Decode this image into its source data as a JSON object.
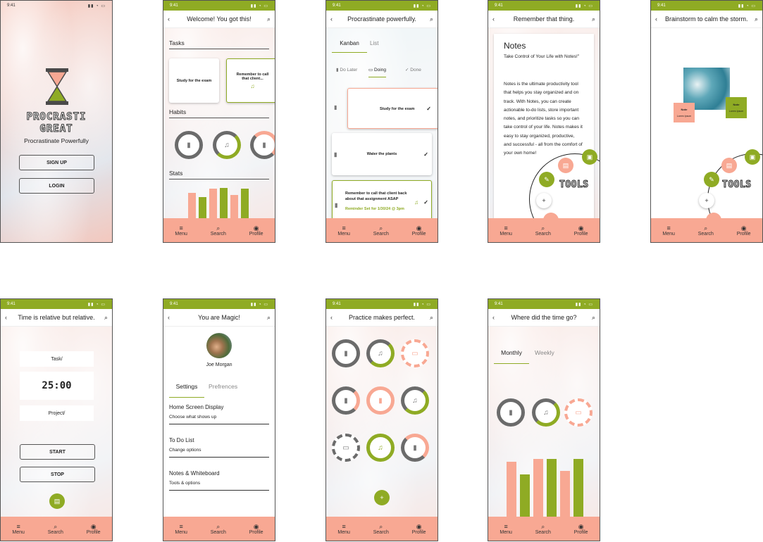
{
  "status_time": "9:41",
  "status_icons": "▮▮ ◔ ▭",
  "tabbar": {
    "menu": "Menu",
    "search": "Search",
    "profile": "Profile"
  },
  "icons": {
    "menu": "menu-icon",
    "search": "search-icon",
    "profile": "profile-icon",
    "back": "back-icon",
    "bookmark": "bookmark-icon",
    "bell": "bell-icon",
    "book": "book-icon",
    "check": "check-icon",
    "plus": "plus-icon"
  },
  "colors": {
    "green": "#8fab24",
    "salmon": "#f8a893",
    "gray": "#707070"
  },
  "s1": {
    "logo_line1": "PROCRASTI",
    "logo_line2": "GREAT",
    "tagline": "Procrastinate Powerfully",
    "signup": "SIGN UP",
    "login": "LOGIN"
  },
  "s2": {
    "title": "Welcome! You got this!",
    "tasks": "Tasks",
    "card1": "Study for the exam",
    "card2": "Remember to call that client...",
    "habits": "Habits",
    "stats": "Stats",
    "habit_progress": [
      0,
      0.5,
      0.4
    ],
    "bars": [
      {
        "v": 0.6,
        "c": "salmon"
      },
      {
        "v": 0.5,
        "c": "green"
      },
      {
        "v": 0.7,
        "c": "salmon"
      },
      {
        "v": 0.72,
        "c": "green"
      },
      {
        "v": 0.55,
        "c": "salmon"
      },
      {
        "v": 0.7,
        "c": "green"
      }
    ]
  },
  "s3": {
    "title": "Procrastinate powerfully.",
    "tab_kanban": "Kanban",
    "tab_list": "List",
    "f_later": "Do Later",
    "f_doing": "Doing",
    "f_done": "Done",
    "c1": "Study for the exam",
    "c2": "Water the plants",
    "c3": "Remember  to call that client back about that assignment ASAP",
    "c3_sub": "Reminder Set for 1/30/24 @ 3pm"
  },
  "s4": {
    "title": "Remember that thing.",
    "heading": "Notes",
    "intro": "Take Control of Your Life with Notes!\"",
    "body": "Notes is the ultimate productivity tool that helps you stay organized and on track. With Notes, you can create actionable to-do lists, store important notes, and prioritize tasks so you can take control of your life. Notes makes it easy to stay organized, productive, and successful - all from the comfort of your own home!",
    "tools": "TOOLS"
  },
  "s5": {
    "title": "Brainstorm to calm the storm.",
    "note1_t": "Note",
    "note1_s": "Lorem Ipsum",
    "note2_t": "Note",
    "note2_s": "Lorem Ipsum",
    "tools": "TOOLS"
  },
  "s6": {
    "title": "Time is relative but relative.",
    "task": "Task/",
    "timer": "25:00",
    "project": "Project/",
    "start": "START",
    "stop": "STOP"
  },
  "s7": {
    "title": "You are Magic!",
    "name": "Joe Morgan",
    "tab_settings": "Settings",
    "tab_prefs": "Prefrences",
    "rows": [
      {
        "label": "Home Screen Display",
        "sub": "Choose what shows up"
      },
      {
        "label": "To Do List",
        "sub": "Change options"
      },
      {
        "label": "Notes & Whiteboard",
        "sub": "Tools & options"
      }
    ]
  },
  "s8": {
    "title": "Practice makes perfect.",
    "habits": [
      {
        "icon": "bookmark-icon",
        "p": 0
      },
      {
        "icon": "bell-icon",
        "p": 0.5
      },
      {
        "icon": "book-icon",
        "p": -1
      },
      {
        "icon": "bookmark-icon",
        "p": 0.4
      },
      {
        "icon": "bookmark-icon",
        "p": 1
      },
      {
        "icon": "bell-icon",
        "p": 0.6
      },
      {
        "icon": "book-icon",
        "p": -2
      },
      {
        "icon": "bell-icon",
        "p": 1
      },
      {
        "icon": "bookmark-icon",
        "p": 0.3
      }
    ]
  },
  "s9": {
    "title": "Where did the time go?",
    "tab_monthly": "Monthly",
    "tab_weekly": "Weekly",
    "bars": [
      {
        "v": 0.78,
        "c": "salmon"
      },
      {
        "v": 0.6,
        "c": "green"
      },
      {
        "v": 0.82,
        "c": "salmon"
      },
      {
        "v": 0.82,
        "c": "green"
      },
      {
        "v": 0.65,
        "c": "salmon"
      },
      {
        "v": 0.82,
        "c": "green"
      }
    ]
  }
}
